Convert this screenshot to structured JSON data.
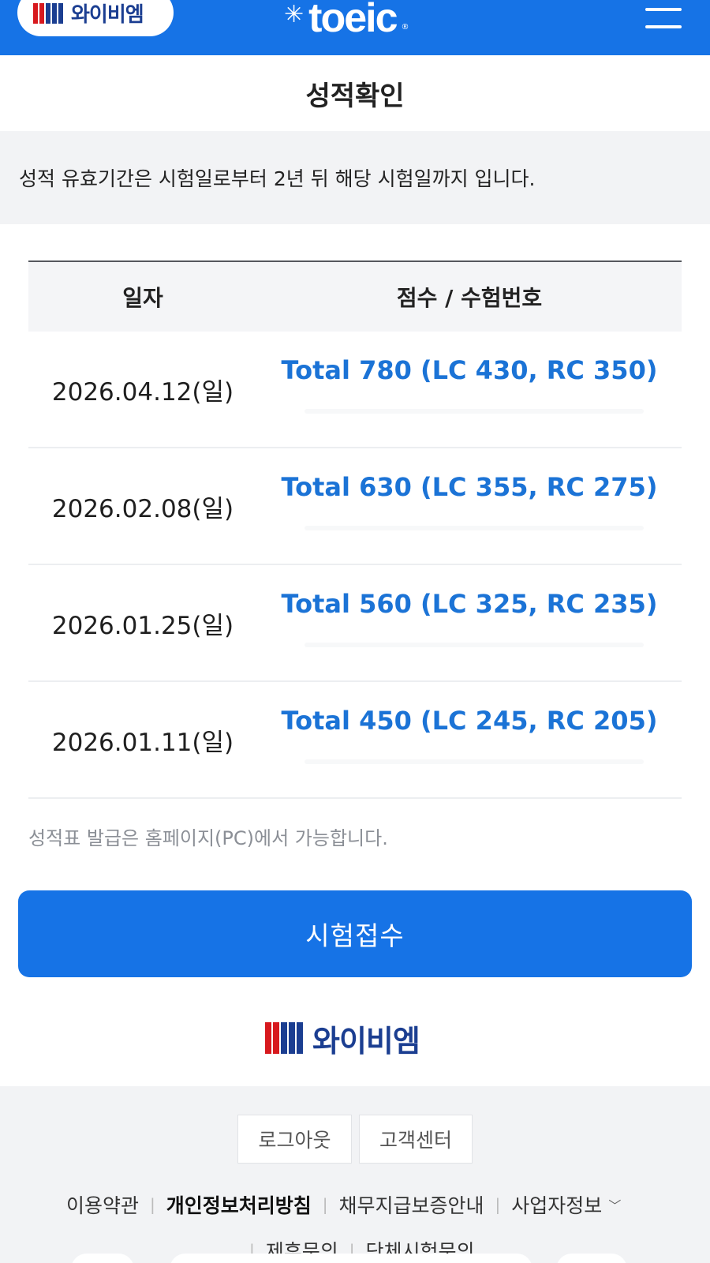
{
  "header": {
    "logo_text": "와이비엠",
    "brand": "toeic",
    "brand_mark": "®",
    "menu_icon": "hamburger-menu-icon"
  },
  "page": {
    "title": "성적확인",
    "notice": "성적 유효기간은 시험일로부터 2년 뒤 해당 시험일까지 입니다."
  },
  "table": {
    "columns": [
      "일자",
      "점수 / 수험번호"
    ],
    "rows": [
      {
        "date": "2026.04.12(일)",
        "score": "Total 780 (LC 430, RC 350)"
      },
      {
        "date": "2026.02.08(일)",
        "score": "Total 630 (LC 355, RC 275)"
      },
      {
        "date": "2026.01.25(일)",
        "score": "Total 560 (LC 325, RC 235)"
      },
      {
        "date": "2026.01.11(일)",
        "score": "Total 450 (LC 245, RC 205)"
      }
    ]
  },
  "note": "성적표 발급은 홈페이지(PC)에서 가능합니다.",
  "register_button": "시험접수",
  "bottom_logo_text": "와이비엠",
  "footer": {
    "buttons": [
      "로그아웃",
      "고객센터"
    ],
    "links": [
      "이용약관",
      "개인정보처리방침",
      "채무지급보증안내",
      "사업자정보"
    ],
    "links2": [
      "제휴문의",
      "단체시험문의"
    ]
  },
  "colors": {
    "primary": "#1673e6",
    "score_text": "#1b73d6",
    "ybm_red": "#d7191e",
    "ybm_navy": "#1b3e91"
  }
}
